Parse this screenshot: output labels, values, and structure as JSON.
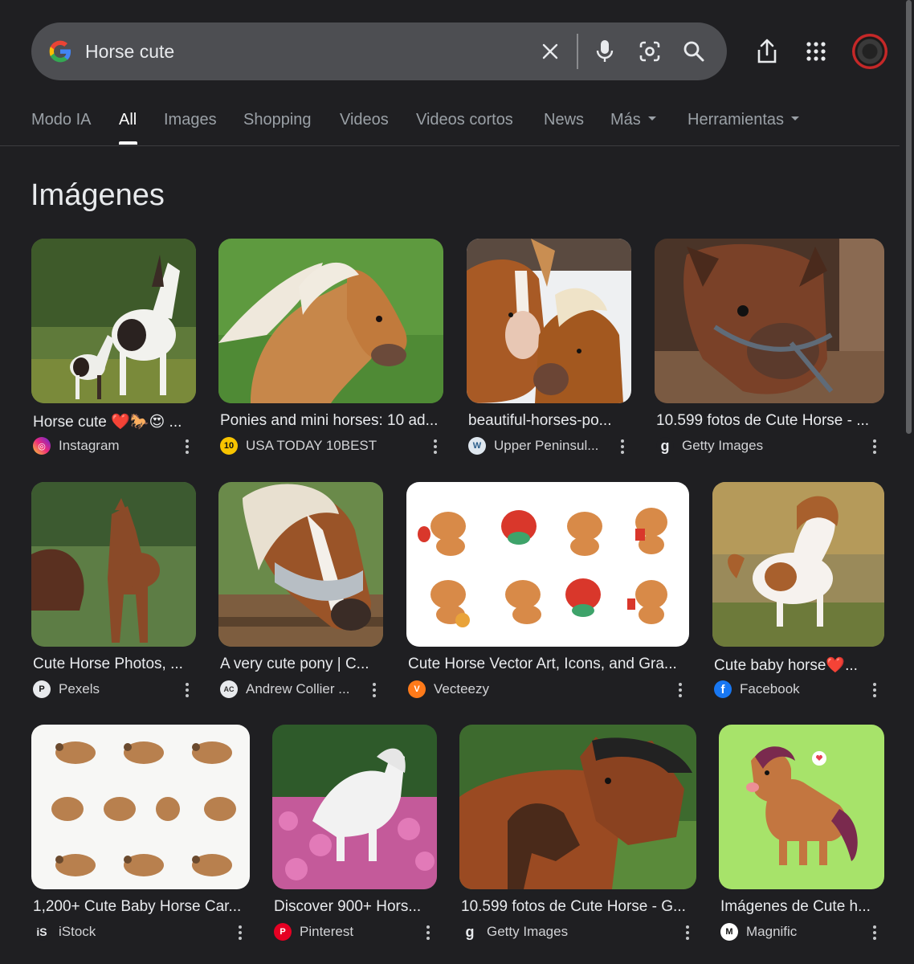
{
  "search": {
    "query": "Horse cute",
    "icons": [
      "google-g-icon",
      "clear-icon",
      "mic-icon",
      "lens-icon",
      "search-icon"
    ]
  },
  "top_actions": [
    "share-icon",
    "apps-grid-icon",
    "account-avatar"
  ],
  "tabs": [
    {
      "label": "Modo IA"
    },
    {
      "label": "All",
      "active": true
    },
    {
      "label": "Images"
    },
    {
      "label": "Shopping"
    },
    {
      "label": "Videos"
    },
    {
      "label": "Videos cortos"
    },
    {
      "label": "News"
    },
    {
      "label": "Más"
    },
    {
      "label": "Herramientas"
    }
  ],
  "section": {
    "title": "Imágenes"
  },
  "results": [
    {
      "title": "Horse cute ❤️🐎😍 ...",
      "source": "Instagram",
      "image": "pinto mare and foal in meadow"
    },
    {
      "title": "Ponies and mini horses: 10 ad...",
      "source": "USA TODAY 10BEST",
      "favicon_text": "10",
      "image": "chestnut pony with blond mane"
    },
    {
      "title": "beautiful-horses-po...",
      "source": "Upper Peninsul...",
      "image": "two chestnut horses nuzzling in snow"
    },
    {
      "title": "10.599 fotos de Cute Horse - ...",
      "source": "Getty Images",
      "favicon_text": "g",
      "image": "brown horse with halter in stable"
    },
    {
      "title": "Cute Horse Photos, ...",
      "source": "Pexels",
      "image": "brown foal standing in field"
    },
    {
      "title": "A very cute pony | C...",
      "source": "Andrew Collier ...",
      "favicon_text": "AC",
      "image": "pony with fly mask over fence"
    },
    {
      "title": "Cute Horse Vector Art, Icons, and Gra...",
      "source": "Vecteezy",
      "favicon_text": "V",
      "image": "cartoon horse stickers with lanterns"
    },
    {
      "title": "Cute baby horse❤️...",
      "source": "Facebook",
      "favicon_text": "f",
      "image": "pinto foal running"
    },
    {
      "title": "1,200+ Cute Baby Horse Car...",
      "source": "iStock",
      "favicon_text": "iS",
      "image": "grid of cartoon horses"
    },
    {
      "title": "Discover 900+ Hors...",
      "source": "Pinterest",
      "favicon_text": "P",
      "image": "white horse in pink flowers"
    },
    {
      "title": "10.599 fotos de Cute Horse - G...",
      "source": "Getty Images",
      "favicon_text": "g",
      "image": "mare and foal playing"
    },
    {
      "title": "Imágenes de Cute h...",
      "source": "Magnific",
      "image": "cartoon horse on green background"
    }
  ],
  "colors": {
    "background": "#1f1f22",
    "searchbar": "#4d4e52",
    "text": "#e8eaed",
    "muted": "#9aa0a6"
  }
}
